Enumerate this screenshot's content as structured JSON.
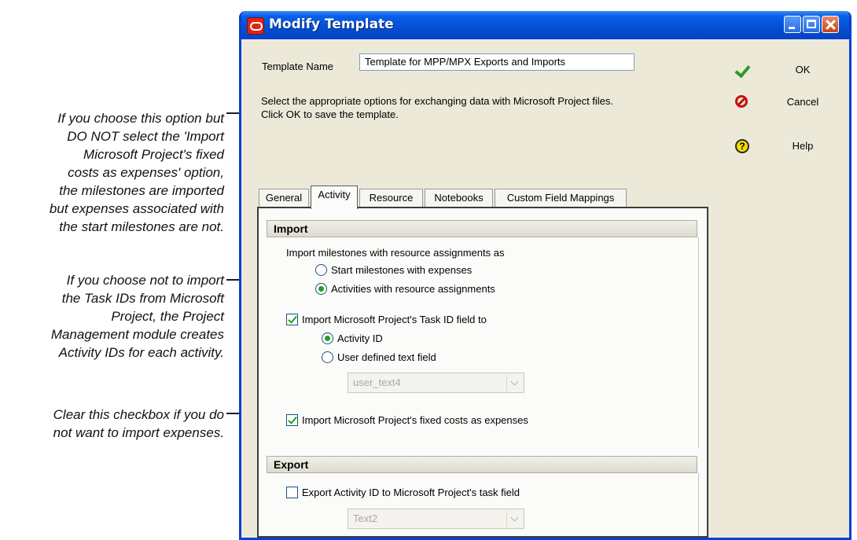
{
  "annotations": [
    "If you choose this option but\nDO NOT select the 'Import\nMicrosoft Project's fixed\ncosts as expenses' option,\nthe milestones are imported\nbut expenses associated with\nthe start milestones are not.",
    "If you choose not to import\nthe Task IDs from Microsoft\nProject, the Project\nManagement module creates\nActivity IDs for each activity.",
    "Clear this checkbox if you do\nnot want to import expenses."
  ],
  "window": {
    "title": "Modify Template"
  },
  "form": {
    "template_name_label": "Template Name",
    "template_name_value": "Template for MPP/MPX Exports and Imports",
    "instructions": "Select the appropriate options for exchanging data with Microsoft Project files.\nClick OK to save the template."
  },
  "buttons": {
    "ok": "OK",
    "cancel": "Cancel",
    "help": "Help"
  },
  "tabs": [
    "General",
    "Activity",
    "Resource",
    "Notebooks",
    "Custom Field Mappings"
  ],
  "active_tab": "Activity",
  "import": {
    "header": "Import",
    "milestones_label": "Import milestones with resource assignments as",
    "milestone_options": [
      "Start milestones with expenses",
      "Activities with resource assignments"
    ],
    "milestone_selected": "Activities with resource assignments",
    "task_id_label": "Import Microsoft Project's Task ID field to",
    "task_id_checked": true,
    "task_id_options": [
      "Activity ID",
      "User defined text field"
    ],
    "task_id_selected": "Activity ID",
    "user_field_value": "user_text4",
    "fixed_costs_label": "Import Microsoft Project's fixed costs as expenses",
    "fixed_costs_checked": true
  },
  "export": {
    "header": "Export",
    "activity_id_label": "Export Activity ID to Microsoft Project's task field",
    "activity_id_checked": false,
    "task_field_value": "Text2"
  }
}
